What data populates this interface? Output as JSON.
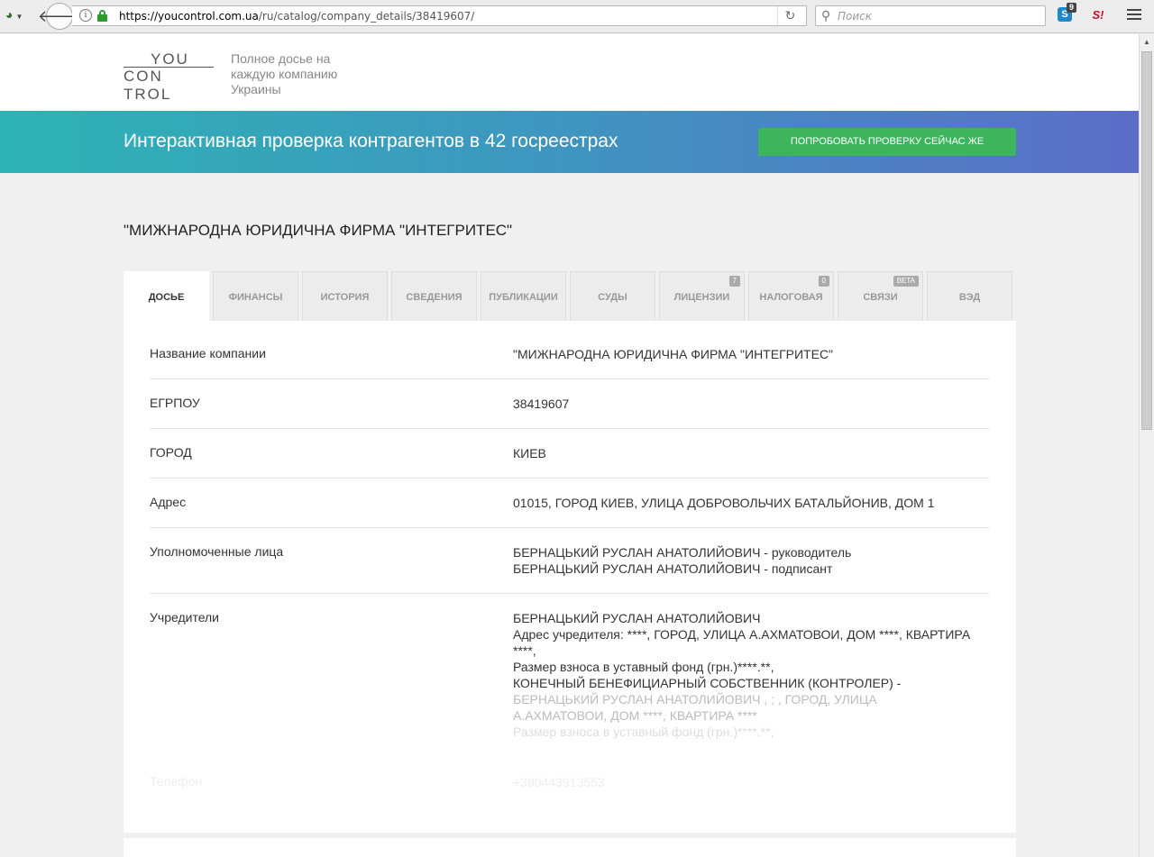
{
  "browser": {
    "url_host": "https://youcontrol.com.ua",
    "url_path": "/ru/catalog/company_details/38419607/",
    "search_placeholder": "Поиск",
    "ext_badge": "9",
    "ext_s_letter": "S",
    "ext_red_letter": "S!"
  },
  "header": {
    "logo_top": "YOU",
    "logo_bottom": "CON TROL",
    "tagline": "Полное досье на каждую компанию Украины"
  },
  "banner": {
    "title": "Интерактивная проверка контрагентов в 42 госреестрах",
    "button": "ПОПРОБОВАТЬ ПРОВЕРКУ СЕЙЧАС ЖЕ"
  },
  "company": {
    "title": "\"МИЖНАРОДНА ЮРИДИЧНА ФИРМА \"ИНТЕГРИТЕС\""
  },
  "tabs": [
    {
      "label": "ДОСЬЕ",
      "badge": ""
    },
    {
      "label": "ФИНАНСЫ",
      "badge": ""
    },
    {
      "label": "ИСТОРИЯ",
      "badge": ""
    },
    {
      "label": "СВЕДЕНИЯ",
      "badge": ""
    },
    {
      "label": "ПУБЛИКАЦИИ",
      "badge": ""
    },
    {
      "label": "СУДЫ",
      "badge": ""
    },
    {
      "label": "ЛИЦЕНЗИИ",
      "badge": "7"
    },
    {
      "label": "НАЛОГОВАЯ",
      "badge": "0"
    },
    {
      "label": "СВЯЗИ",
      "badge": "Beta"
    },
    {
      "label": "ВЭД",
      "badge": ""
    }
  ],
  "details": {
    "name_label": "Название компании",
    "name_value": "\"МИЖНАРОДНА ЮРИДИЧНА ФИРМА \"ИНТЕГРИТЕС\"",
    "edrpou_label": "ЕГРПОУ",
    "edrpou_value": "38419607",
    "city_label": "ГОРОД",
    "city_value": "КИЕВ",
    "address_label": "Адрес",
    "address_value": "01015, ГОРОД КИЕВ, УЛИЦА ДОБРОВОЛЬЧИХ БАТАЛЬЙОНИВ, ДОМ 1",
    "persons_label": "Уполномоченные лица",
    "persons": [
      "БЕРНАЦЬКИЙ РУСЛАН АНАТОЛИЙОВИЧ - руководитель",
      "БЕРНАЦЬКИЙ РУСЛАН АНАТОЛИЙОВИЧ - подписант"
    ],
    "founders_label": "Учредители",
    "founders": [
      "БЕРНАЦЬКИЙ РУСЛАН АНАТОЛИЙОВИЧ",
      "Адрес учредителя: ****, ГОРОД, УЛИЦА А.АХМАТОВОИ, ДОМ ****, КВАРТИРА ****,",
      "Размер взноса в уставный фонд (грн.)****.**,",
      "КОНЕЧНЫЙ БЕНЕФИЦИАРНЫЙ СОБСТВЕННИК (КОНТРОЛЕР) -",
      "БЕРНАЦЬКИЙ РУСЛАН АНАТОЛИЙОВИЧ , ; , ГОРОД, УЛИЦА А.АХМАТОВОИ, ДОМ ****, КВАРТИРА ****",
      "Размер взноса в уставный фонд (грн.)****.**,"
    ],
    "phone_label": "Телефон",
    "phone_value": "+380443913553"
  }
}
